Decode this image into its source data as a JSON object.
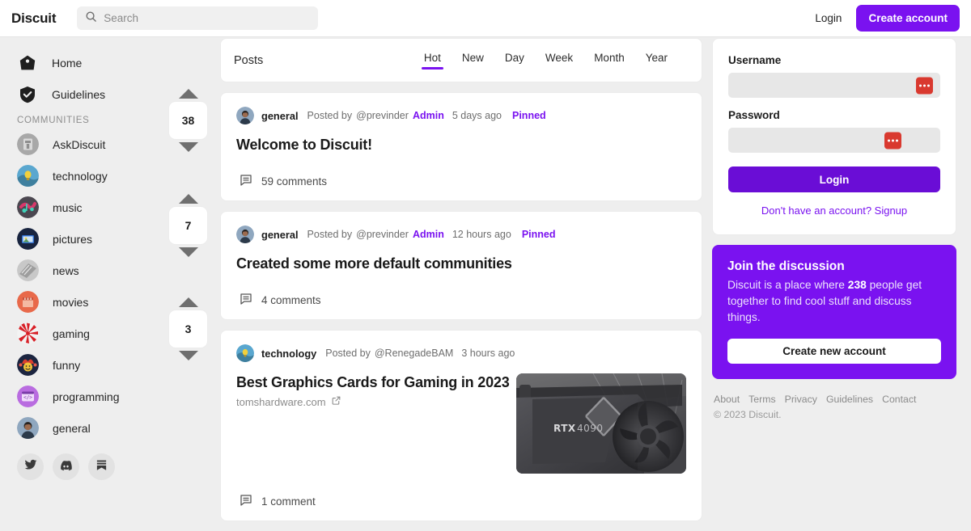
{
  "navbar": {
    "brand": "Discuit",
    "search_placeholder": "Search",
    "search_value": "",
    "search_icon": "search-icon",
    "login_label": "Login",
    "create_account_label": "Create account"
  },
  "colors": {
    "accent": "#7a12f0",
    "accent_dark": "#6a0dd6",
    "page_bg": "#eeeeee",
    "card_bg": "#ffffff",
    "password_manager_icon": "#d9392f"
  },
  "sidebar": {
    "main_items": [
      {
        "label": "Home",
        "icon": "home-icon"
      },
      {
        "label": "Guidelines",
        "icon": "shield-check-icon"
      }
    ],
    "section_heading": "COMMUNITIES",
    "communities": [
      {
        "label": "AskDiscuit"
      },
      {
        "label": "technology"
      },
      {
        "label": "music"
      },
      {
        "label": "pictures"
      },
      {
        "label": "news"
      },
      {
        "label": "movies"
      },
      {
        "label": "gaming"
      },
      {
        "label": "funny"
      },
      {
        "label": "programming"
      },
      {
        "label": "general"
      }
    ],
    "socials": [
      {
        "name": "twitter-icon"
      },
      {
        "name": "discord-icon"
      },
      {
        "name": "substack-icon"
      }
    ]
  },
  "feed": {
    "header": {
      "title": "Posts",
      "tabs": [
        {
          "label": "Hot",
          "active": true
        },
        {
          "label": "New",
          "active": false
        },
        {
          "label": "Day",
          "active": false
        },
        {
          "label": "Week",
          "active": false
        },
        {
          "label": "Month",
          "active": false
        },
        {
          "label": "Year",
          "active": false
        }
      ]
    },
    "posts": [
      {
        "votes": "38",
        "community": "general",
        "posted_by": "Posted by",
        "username": "@previnder",
        "badge": "Admin",
        "time": "5 days ago",
        "pinned": "Pinned",
        "title": "Welcome to Discuit!",
        "domain": "",
        "comments": "59 comments",
        "thumbnail": false
      },
      {
        "votes": "7",
        "community": "general",
        "posted_by": "Posted by",
        "username": "@previnder",
        "badge": "Admin",
        "time": "12 hours ago",
        "pinned": "Pinned",
        "title": "Created some more default communities",
        "domain": "",
        "comments": "4 comments",
        "thumbnail": false
      },
      {
        "votes": "3",
        "community": "technology",
        "posted_by": "Posted by",
        "username": "@RenegadeBAM",
        "badge": "",
        "time": "3 hours ago",
        "pinned": "",
        "title": "Best Graphics Cards for Gaming in 2023",
        "domain": "tomshardware.com",
        "comments": "1 comment",
        "thumbnail": true,
        "thumbnail_alt": "RTX 4090"
      }
    ]
  },
  "rail": {
    "login": {
      "username_label": "Username",
      "username_value": "",
      "password_label": "Password",
      "password_value": "",
      "submit_label": "Login",
      "signup_text": "Don't have an account? Signup",
      "autofill_icon": "password-manager-icon"
    },
    "join": {
      "title": "Join the discussion",
      "text_before": "Discuit is a place where ",
      "count": "238",
      "text_after": " people get together to find cool stuff and discuss things.",
      "button_label": "Create new account"
    },
    "footer": {
      "links": [
        "About",
        "Terms",
        "Privacy",
        "Guidelines",
        "Contact"
      ],
      "copyright": "© 2023 Discuit."
    }
  }
}
